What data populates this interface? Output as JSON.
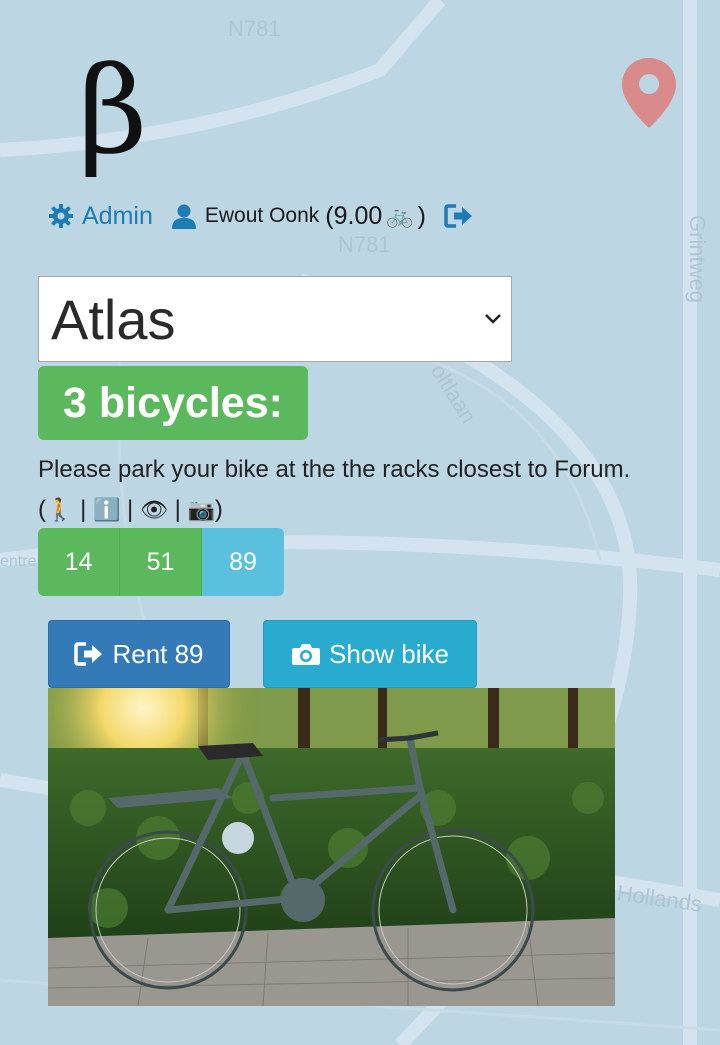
{
  "app": {
    "logo_text": "β"
  },
  "user_bar": {
    "admin_label": "Admin",
    "user_name": "Ewout Oonk",
    "credits_open": "(9.00",
    "credits_close": ")",
    "bike_emoji": "🚲"
  },
  "location": {
    "selected": "Atlas"
  },
  "bikes": {
    "count_label": "3 bicycles:",
    "park_note_text": "Please park your bike at the the racks closest to Forum. (",
    "emoji_walk": "🚶",
    "emoji_info": "ℹ️",
    "emoji_eye": "👁",
    "emoji_camera": "📷",
    "separator": " | ",
    "close_paren": ")",
    "tabs": [
      "14",
      "51",
      "89"
    ],
    "active_tab": "89"
  },
  "actions": {
    "rent_label": "Rent 89",
    "show_bike_label": "Show bike"
  },
  "map_labels": {
    "road1": "N781",
    "road2": "N781",
    "street1": "Grintweg",
    "street2": "Hollands",
    "street3": "oltlaan",
    "street4": "entre"
  },
  "colors": {
    "success": "#5cb85c",
    "info": "#5bc0de",
    "primary": "#337ab7",
    "link": "#1d7cb4",
    "pin": "#d98a8a"
  }
}
